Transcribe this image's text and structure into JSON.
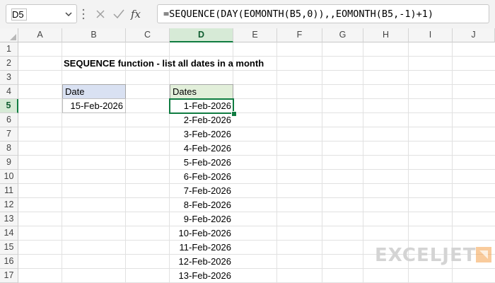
{
  "formula_bar": {
    "name_box": "D5",
    "formula": "=SEQUENCE(DAY(EOMONTH(B5,0)),,EOMONTH(B5,-1)+1)",
    "icons": [
      "cancel-icon",
      "enter-icon",
      "fx-icon"
    ]
  },
  "columns": [
    "A",
    "B",
    "C",
    "D",
    "E",
    "F",
    "G",
    "H",
    "I",
    "J"
  ],
  "rows": [
    "1",
    "2",
    "3",
    "4",
    "5",
    "6",
    "7",
    "8",
    "9",
    "10",
    "11",
    "12",
    "13",
    "14",
    "15",
    "16",
    "17"
  ],
  "active": {
    "column": "D",
    "row": "5"
  },
  "sheet": {
    "title": "SEQUENCE function - list all dates in a month",
    "date_header": "Date",
    "date_value": "15-Feb-2026",
    "dates_header": "Dates",
    "dates": [
      "1-Feb-2026",
      "2-Feb-2026",
      "3-Feb-2026",
      "4-Feb-2026",
      "5-Feb-2026",
      "6-Feb-2026",
      "7-Feb-2026",
      "8-Feb-2026",
      "9-Feb-2026",
      "10-Feb-2026",
      "11-Feb-2026",
      "12-Feb-2026",
      "13-Feb-2026"
    ]
  },
  "colors": {
    "accent": "#107c41",
    "header_blue": "#d9e1f2",
    "header_green": "#e2efda",
    "logo_orange": "#f4a04a"
  },
  "logo": {
    "text": "EXCELJET"
  }
}
